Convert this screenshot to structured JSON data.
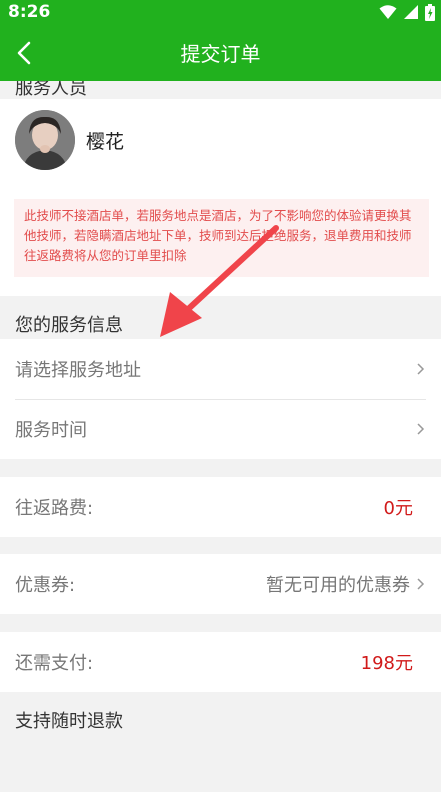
{
  "status": {
    "time": "8:26"
  },
  "nav": {
    "title": "提交订单"
  },
  "staff": {
    "header": "服务人员",
    "name": "樱花"
  },
  "notice": "此技师不接酒店单，若服务地点是酒店，为了不影响您的体验请更换其他技师，若隐瞒酒店地址下单，技师到达后拒绝服务，退单费用和技师往返路费将从您的订单里扣除",
  "service_info": {
    "header": "您的服务信息",
    "address_placeholder": "请选择服务地址",
    "time_label": "服务时间"
  },
  "fees": {
    "travel_label": "往返路费:",
    "travel_value": "0元",
    "coupon_label": "优惠券:",
    "coupon_value": "暂无可用的优惠券",
    "pay_label": "还需支付:",
    "pay_value": "198元"
  },
  "refund": "支持随时退款",
  "colors": {
    "brand_green": "#21b11e",
    "price_red": "#d11a1a",
    "notice_red": "#e24c4c",
    "arrow_red": "#f0444a"
  }
}
